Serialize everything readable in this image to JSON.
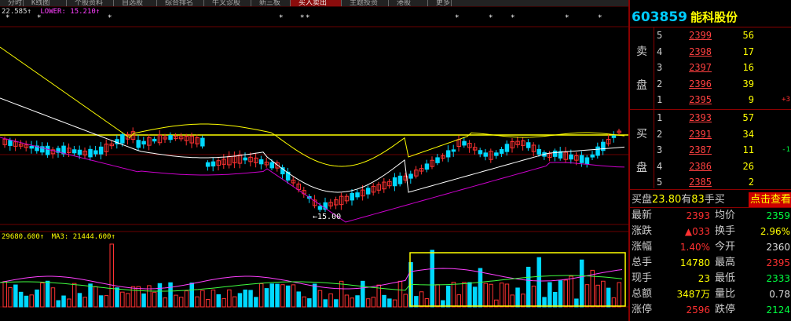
{
  "tabs": [
    "分时",
    "K线图",
    "个股资料",
    "自选股",
    "综合排名",
    "牛叉诊股",
    "新三板",
    "买入卖出",
    "主题投资",
    "港股",
    "更多"
  ],
  "active_tab_index": 7,
  "indicator": {
    "prefix": "22.585↑",
    "lower": "LOWER: 15.210↑"
  },
  "volume_indicator": {
    "vol": "29680.600↑",
    "ma3": "MA3: 21444.600↑"
  },
  "low_annotation": "←15.00",
  "colors": {
    "up": "#ff3232",
    "down": "#00d8ff",
    "ma": "#ffff00",
    "lower": "#cc00cc",
    "mid": "#ffffff",
    "border": "#8b0000"
  },
  "stock": {
    "code": "603859",
    "name": "能科股份"
  },
  "sell_label": [
    "卖",
    "盘"
  ],
  "buy_label": [
    "买",
    "盘"
  ],
  "sell_orders": [
    {
      "level": "5",
      "price": "2399",
      "qty": "56",
      "change": ""
    },
    {
      "level": "4",
      "price": "2398",
      "qty": "17",
      "change": ""
    },
    {
      "level": "3",
      "price": "2397",
      "qty": "16",
      "change": ""
    },
    {
      "level": "2",
      "price": "2396",
      "qty": "39",
      "change": ""
    },
    {
      "level": "1",
      "price": "2395",
      "qty": "9",
      "change": "+3"
    }
  ],
  "buy_orders": [
    {
      "level": "1",
      "price": "2393",
      "qty": "57",
      "change": ""
    },
    {
      "level": "2",
      "price": "2391",
      "qty": "34",
      "change": ""
    },
    {
      "level": "3",
      "price": "2387",
      "qty": "11",
      "change": "-1"
    },
    {
      "level": "4",
      "price": "2386",
      "qty": "26",
      "change": ""
    },
    {
      "level": "5",
      "price": "2385",
      "qty": "2",
      "change": ""
    }
  ],
  "banner": {
    "label1": "买盘",
    "value1": "23.80",
    "mid": "有",
    "value2": "83",
    "label2": "手买",
    "button": "点击查看"
  },
  "quote": [
    {
      "l1": "最新",
      "v1": "2393",
      "c1": "red",
      "l2": "均价",
      "v2": "2359",
      "c2": "grn"
    },
    {
      "l1": "涨跌",
      "v1": "▲033",
      "c1": "red",
      "l2": "换手",
      "v2": "2.96%",
      "c2": "yel"
    },
    {
      "l1": "涨幅",
      "v1": "1.40%",
      "c1": "red",
      "l2": "今开",
      "v2": "2360",
      "c2": "wht"
    },
    {
      "l1": "总手",
      "v1": "14780",
      "c1": "yel",
      "l2": "最高",
      "v2": "2395",
      "c2": "red"
    },
    {
      "l1": "现手",
      "v1": "23",
      "c1": "yel",
      "l2": "最低",
      "v2": "2333",
      "c2": "grn"
    },
    {
      "l1": "总额",
      "v1": "3487万",
      "c1": "yel",
      "l2": "量比",
      "v2": "0.78",
      "c2": "wht"
    },
    {
      "l1": "涨停",
      "v1": "2596",
      "c1": "red",
      "l2": "跌停",
      "v2": "2124",
      "c2": "grn"
    }
  ]
}
